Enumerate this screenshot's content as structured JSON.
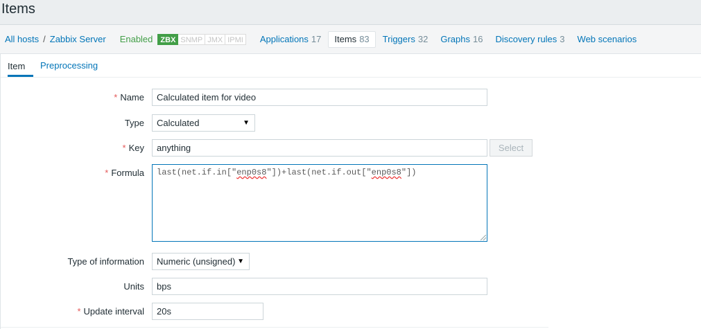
{
  "page": {
    "title": "Items"
  },
  "nav": {
    "all_hosts": "All hosts",
    "separator": "/",
    "host": "Zabbix Server",
    "status": "Enabled",
    "availability": [
      "ZBX",
      "SNMP",
      "JMX",
      "IPMI"
    ],
    "tabs": [
      {
        "label": "Applications",
        "count": "17"
      },
      {
        "label": "Items",
        "count": "83"
      },
      {
        "label": "Triggers",
        "count": "32"
      },
      {
        "label": "Graphs",
        "count": "16"
      },
      {
        "label": "Discovery rules",
        "count": "3"
      },
      {
        "label": "Web scenarios",
        "count": ""
      }
    ]
  },
  "form_tabs": [
    "Item",
    "Preprocessing"
  ],
  "form": {
    "name": {
      "label": "Name",
      "value": "Calculated item for video"
    },
    "type": {
      "label": "Type",
      "value": "Calculated"
    },
    "key": {
      "label": "Key",
      "value": "anything",
      "button": "Select"
    },
    "formula": {
      "label": "Formula",
      "parts": [
        "last(net.if.in[\"",
        "enp0s8",
        "\"])+last(net.if.out[\"",
        "enp0s8",
        "\"])"
      ]
    },
    "type_of_information": {
      "label": "Type of information",
      "value": "Numeric (unsigned)"
    },
    "units": {
      "label": "Units",
      "value": "bps"
    },
    "update_interval": {
      "label": "Update interval",
      "value": "20s"
    }
  },
  "colors": {
    "link": "#0275b8",
    "enabled": "#429e47",
    "required": "#e45959"
  }
}
